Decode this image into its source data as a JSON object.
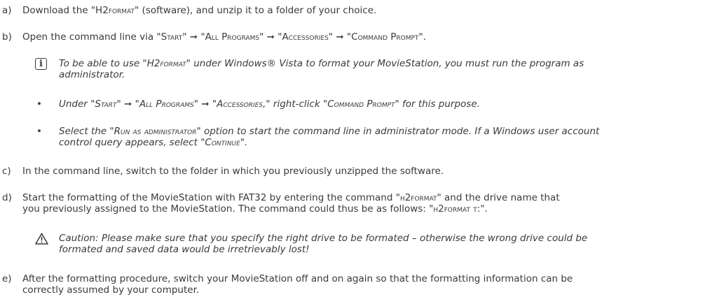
{
  "steps": {
    "a": {
      "letter": "a)",
      "p1": "Download the \"H2",
      "p1sc": "format",
      "p1b": "\" (software), and unzip it to a folder of your choice."
    },
    "b": {
      "letter": "b)",
      "t1": "Open the command line via \"",
      "m1": "Start",
      "arrow": "➞",
      "m2": "All Programs",
      "m3": "Accessories",
      "m4": "Command Prompt",
      "t5": "\"."
    },
    "c": {
      "letter": "c)",
      "text": "In the command line, switch to the folder in which you previously unzipped the software."
    },
    "d": {
      "letter": "d)",
      "l1a": "Start the formatting of the MovieStation with FAT32 by entering the command \"",
      "l1sc": "h2format",
      "l1b": "\" and the drive name that",
      "l2a": "you previously assigned to the MovieStation. The command could thus be as follows: \"",
      "l2sc": "h2format t:",
      "l2b": "\"."
    },
    "e": {
      "letter": "e)",
      "l1": "After the formatting procedure, switch your MovieStation off and on again so that the formatting information can be",
      "l2": "correctly assumed by your computer."
    }
  },
  "info_note": {
    "icon": "i",
    "l1a": "To be able to use \"H2",
    "l1sc": "format",
    "l1b": "\" under Windows® Vista to format your MovieStation, you must run the program as",
    "l2": "administrator."
  },
  "bullets": {
    "b1": {
      "dot": "•",
      "a": "Under \"",
      "m1": "Start",
      "arrow": "➞",
      "m2": "All Programs",
      "m3": "Accessories",
      "b": ",\" right-click \"",
      "m4": "Command Prompt",
      "c": "\" for this purpose."
    },
    "b2": {
      "dot": "•",
      "a": "Select the \"",
      "m1": "Run as administrator",
      "b": "\" option to start the command line in administrator mode. If a Windows user account",
      "l2a": "control query appears, select \"",
      "m2": "Continue",
      "l2b": "\"."
    }
  },
  "caution_note": {
    "l1": "Caution: Please make sure that you specify the right drive to be formated – otherwise the wrong drive could be",
    "l2": "formated and saved data would be irretrievably lost!"
  }
}
